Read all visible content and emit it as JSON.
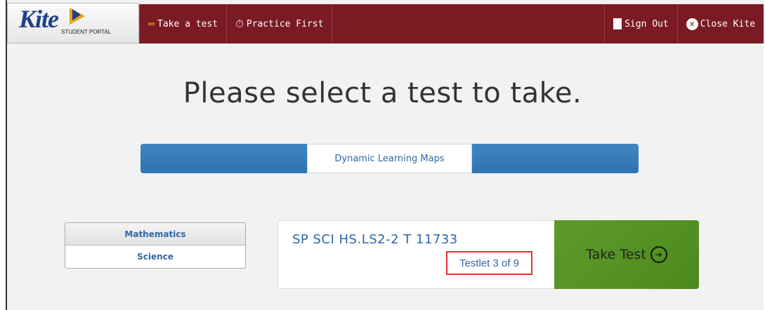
{
  "header": {
    "logo_text": "Kite",
    "logo_subtext": "STUDENT PORTAL",
    "nav_left": [
      {
        "label": "Take a test",
        "icon": "pencil-icon"
      },
      {
        "label": "Practice First",
        "icon": "timer-icon"
      }
    ],
    "nav_right": [
      {
        "label": "Sign Out",
        "icon": "sign-out-icon"
      },
      {
        "label": "Close Kite",
        "icon": "close-icon"
      }
    ]
  },
  "page_title": "Please select a test to take.",
  "tabs": {
    "active": "Dynamic Learning Maps"
  },
  "subjects": [
    {
      "label": "Mathematics",
      "selected": true
    },
    {
      "label": "Science",
      "selected": false
    }
  ],
  "test_card": {
    "name": "SP SCI HS.LS2-2 T 11733",
    "testlet": "Testlet 3 of 9",
    "action_label": "Take Test"
  },
  "colors": {
    "header_bg": "#7a1a22",
    "tab_blue": "#2f74b0",
    "take_test_green": "#5e9a2a",
    "highlight_red": "#e03030"
  }
}
